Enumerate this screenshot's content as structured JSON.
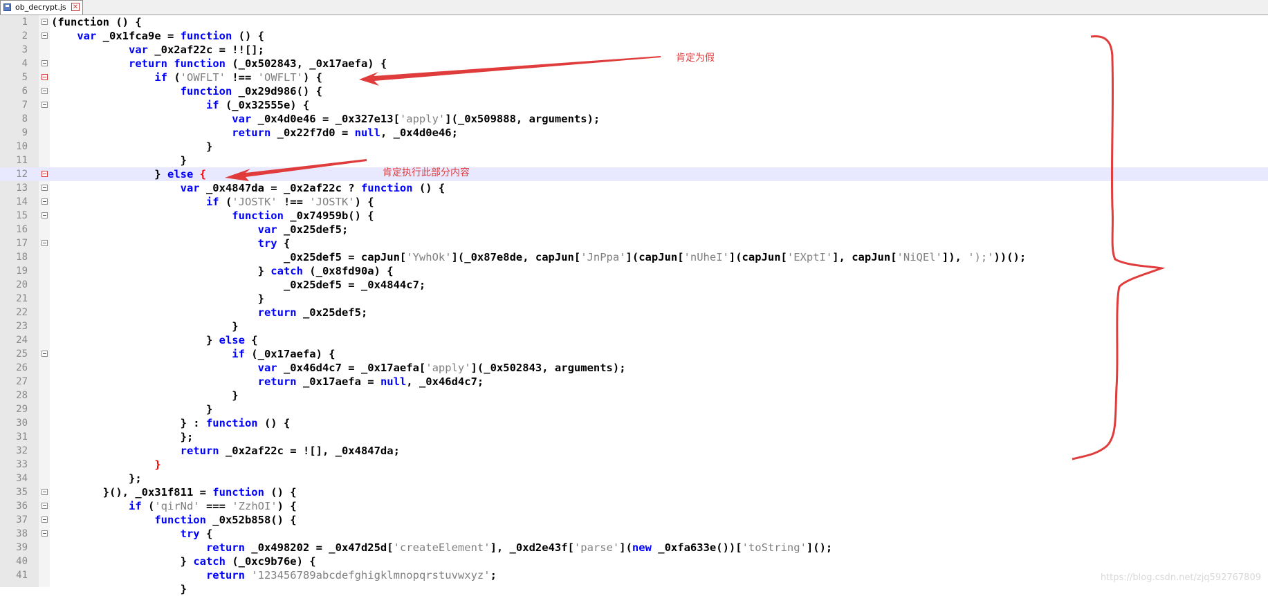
{
  "tab": {
    "filename": "ob_decrypt.js",
    "close_glyph": "✕"
  },
  "annotations": {
    "note1": "肯定为假",
    "note2": "肯定执行此部分内容"
  },
  "watermark": "https://blog.csdn.net/zjq592767809",
  "colors": {
    "keyword": "#0000ff",
    "string": "#808080",
    "annotation": "#e03c3c",
    "current_line": "#e8e8ff"
  },
  "lines": [
    {
      "n": "1",
      "fold": "box",
      "segs": [
        [
          "p",
          "(function () {"
        ]
      ]
    },
    {
      "n": "2",
      "fold": "box",
      "segs": [
        [
          "p",
          "    "
        ],
        [
          "k",
          "var"
        ],
        [
          "p",
          " _0x1fca9e = "
        ],
        [
          "k",
          "function"
        ],
        [
          "p",
          " () {"
        ]
      ]
    },
    {
      "n": "3",
      "segs": [
        [
          "p",
          "            "
        ],
        [
          "k",
          "var"
        ],
        [
          "p",
          " _0x2af22c = !![];"
        ]
      ]
    },
    {
      "n": "4",
      "fold": "box",
      "segs": [
        [
          "p",
          "            "
        ],
        [
          "k",
          "return"
        ],
        [
          "p",
          " "
        ],
        [
          "k",
          "function"
        ],
        [
          "p",
          " (_0x502843, _0x17aefa) {"
        ]
      ]
    },
    {
      "n": "5",
      "fold": "red",
      "segs": [
        [
          "p",
          "                "
        ],
        [
          "k",
          "if"
        ],
        [
          "p",
          " ("
        ],
        [
          "s",
          "'OWFLT'"
        ],
        [
          "p",
          " !== "
        ],
        [
          "s",
          "'OWFLT'"
        ],
        [
          "p",
          ") {"
        ]
      ]
    },
    {
      "n": "6",
      "fold": "box",
      "segs": [
        [
          "p",
          "                    "
        ],
        [
          "k",
          "function"
        ],
        [
          "p",
          " _0x29d986() {"
        ]
      ]
    },
    {
      "n": "7",
      "fold": "box",
      "segs": [
        [
          "p",
          "                        "
        ],
        [
          "k",
          "if"
        ],
        [
          "p",
          " (_0x32555e) {"
        ]
      ]
    },
    {
      "n": "8",
      "segs": [
        [
          "p",
          "                            "
        ],
        [
          "k",
          "var"
        ],
        [
          "p",
          " _0x4d0e46 = _0x327e13["
        ],
        [
          "s",
          "'apply'"
        ],
        [
          "p",
          "](_0x509888, arguments);"
        ]
      ]
    },
    {
      "n": "9",
      "segs": [
        [
          "p",
          "                            "
        ],
        [
          "k",
          "return"
        ],
        [
          "p",
          " _0x22f7d0 = "
        ],
        [
          "k",
          "null"
        ],
        [
          "p",
          ", _0x4d0e46;"
        ]
      ]
    },
    {
      "n": "10",
      "segs": [
        [
          "p",
          "                        }"
        ]
      ]
    },
    {
      "n": "11",
      "segs": [
        [
          "p",
          "                    }"
        ]
      ]
    },
    {
      "n": "12",
      "fold": "red",
      "current": true,
      "segs": [
        [
          "p",
          "                } "
        ],
        [
          "k",
          "else"
        ],
        [
          "p",
          " "
        ],
        [
          "r",
          "{"
        ]
      ]
    },
    {
      "n": "13",
      "fold": "box",
      "segs": [
        [
          "p",
          "                    "
        ],
        [
          "k",
          "var"
        ],
        [
          "p",
          " _0x4847da = _0x2af22c ? "
        ],
        [
          "k",
          "function"
        ],
        [
          "p",
          " () {"
        ]
      ]
    },
    {
      "n": "14",
      "fold": "box",
      "segs": [
        [
          "p",
          "                        "
        ],
        [
          "k",
          "if"
        ],
        [
          "p",
          " ("
        ],
        [
          "s",
          "'JOSTK'"
        ],
        [
          "p",
          " !== "
        ],
        [
          "s",
          "'JOSTK'"
        ],
        [
          "p",
          ") {"
        ]
      ]
    },
    {
      "n": "15",
      "fold": "box",
      "segs": [
        [
          "p",
          "                            "
        ],
        [
          "k",
          "function"
        ],
        [
          "p",
          " _0x74959b() {"
        ]
      ]
    },
    {
      "n": "16",
      "segs": [
        [
          "p",
          "                                "
        ],
        [
          "k",
          "var"
        ],
        [
          "p",
          " _0x25def5;"
        ]
      ]
    },
    {
      "n": "17",
      "fold": "box",
      "segs": [
        [
          "p",
          "                                "
        ],
        [
          "k",
          "try"
        ],
        [
          "p",
          " {"
        ]
      ]
    },
    {
      "n": "18",
      "segs": [
        [
          "p",
          "                                    _0x25def5 = capJun["
        ],
        [
          "s",
          "'YwhOk'"
        ],
        [
          "p",
          "](_0x87e8de, capJun["
        ],
        [
          "s",
          "'JnPpa'"
        ],
        [
          "p",
          "](capJun["
        ],
        [
          "s",
          "'nUheI'"
        ],
        [
          "p",
          "](capJun["
        ],
        [
          "s",
          "'EXptI'"
        ],
        [
          "p",
          "], capJun["
        ],
        [
          "s",
          "'NiQEl'"
        ],
        [
          "p",
          "]), "
        ],
        [
          "s",
          "');'"
        ],
        [
          "p",
          "))();"
        ]
      ]
    },
    {
      "n": "19",
      "segs": [
        [
          "p",
          "                                } "
        ],
        [
          "k",
          "catch"
        ],
        [
          "p",
          " (_0x8fd90a) {"
        ]
      ]
    },
    {
      "n": "20",
      "segs": [
        [
          "p",
          "                                    _0x25def5 = _0x4844c7;"
        ]
      ]
    },
    {
      "n": "21",
      "segs": [
        [
          "p",
          "                                }"
        ]
      ]
    },
    {
      "n": "22",
      "segs": [
        [
          "p",
          "                                "
        ],
        [
          "k",
          "return"
        ],
        [
          "p",
          " _0x25def5;"
        ]
      ]
    },
    {
      "n": "23",
      "segs": [
        [
          "p",
          "                            }"
        ]
      ]
    },
    {
      "n": "24",
      "segs": [
        [
          "p",
          "                        } "
        ],
        [
          "k",
          "else"
        ],
        [
          "p",
          " {"
        ]
      ]
    },
    {
      "n": "25",
      "fold": "box",
      "segs": [
        [
          "p",
          "                            "
        ],
        [
          "k",
          "if"
        ],
        [
          "p",
          " (_0x17aefa) {"
        ]
      ]
    },
    {
      "n": "26",
      "segs": [
        [
          "p",
          "                                "
        ],
        [
          "k",
          "var"
        ],
        [
          "p",
          " _0x46d4c7 = _0x17aefa["
        ],
        [
          "s",
          "'apply'"
        ],
        [
          "p",
          "](_0x502843, arguments);"
        ]
      ]
    },
    {
      "n": "27",
      "segs": [
        [
          "p",
          "                                "
        ],
        [
          "k",
          "return"
        ],
        [
          "p",
          " _0x17aefa = "
        ],
        [
          "k",
          "null"
        ],
        [
          "p",
          ", _0x46d4c7;"
        ]
      ]
    },
    {
      "n": "28",
      "segs": [
        [
          "p",
          "                            }"
        ]
      ]
    },
    {
      "n": "29",
      "segs": [
        [
          "p",
          "                        }"
        ]
      ]
    },
    {
      "n": "30",
      "segs": [
        [
          "p",
          "                    } : "
        ],
        [
          "k",
          "function"
        ],
        [
          "p",
          " () {"
        ]
      ]
    },
    {
      "n": "31",
      "segs": [
        [
          "p",
          "                    };"
        ]
      ]
    },
    {
      "n": "32",
      "segs": [
        [
          "p",
          "                    "
        ],
        [
          "k",
          "return"
        ],
        [
          "p",
          " _0x2af22c = ![], _0x4847da;"
        ]
      ]
    },
    {
      "n": "33",
      "segs": [
        [
          "p",
          "                "
        ],
        [
          "r",
          "}"
        ]
      ]
    },
    {
      "n": "34",
      "segs": [
        [
          "p",
          "            };"
        ]
      ]
    },
    {
      "n": "35",
      "fold": "box",
      "segs": [
        [
          "p",
          "        }(), _0x31f811 = "
        ],
        [
          "k",
          "function"
        ],
        [
          "p",
          " () {"
        ]
      ]
    },
    {
      "n": "36",
      "fold": "box",
      "segs": [
        [
          "p",
          "            "
        ],
        [
          "k",
          "if"
        ],
        [
          "p",
          " ("
        ],
        [
          "s",
          "'qirNd'"
        ],
        [
          "p",
          " === "
        ],
        [
          "s",
          "'ZzhOI'"
        ],
        [
          "p",
          ") {"
        ]
      ]
    },
    {
      "n": "37",
      "fold": "box",
      "segs": [
        [
          "p",
          "                "
        ],
        [
          "k",
          "function"
        ],
        [
          "p",
          " _0x52b858() {"
        ]
      ]
    },
    {
      "n": "38",
      "fold": "box",
      "segs": [
        [
          "p",
          "                    "
        ],
        [
          "k",
          "try"
        ],
        [
          "p",
          " {"
        ]
      ]
    },
    {
      "n": "39",
      "segs": [
        [
          "p",
          "                        "
        ],
        [
          "k",
          "return"
        ],
        [
          "p",
          " _0x498202 = _0x47d25d["
        ],
        [
          "s",
          "'createElement'"
        ],
        [
          "p",
          "], _0xd2e43f["
        ],
        [
          "s",
          "'parse'"
        ],
        [
          "p",
          "]("
        ],
        [
          "k",
          "new"
        ],
        [
          "p",
          " _0xfa633e())["
        ],
        [
          "s",
          "'toString'"
        ],
        [
          "p",
          "]();"
        ]
      ]
    },
    {
      "n": "40",
      "segs": [
        [
          "p",
          "                    } "
        ],
        [
          "k",
          "catch"
        ],
        [
          "p",
          " (_0xc9b76e) {"
        ]
      ]
    },
    {
      "n": "41",
      "segs": [
        [
          "p",
          "                        "
        ],
        [
          "k",
          "return"
        ],
        [
          "p",
          " "
        ],
        [
          "s",
          "'123456789abcdefghigklmnopqrstuvwxyz'"
        ],
        [
          "p",
          ";"
        ]
      ]
    },
    {
      "n": "",
      "segs": [
        [
          "p",
          "                    }"
        ]
      ]
    }
  ]
}
